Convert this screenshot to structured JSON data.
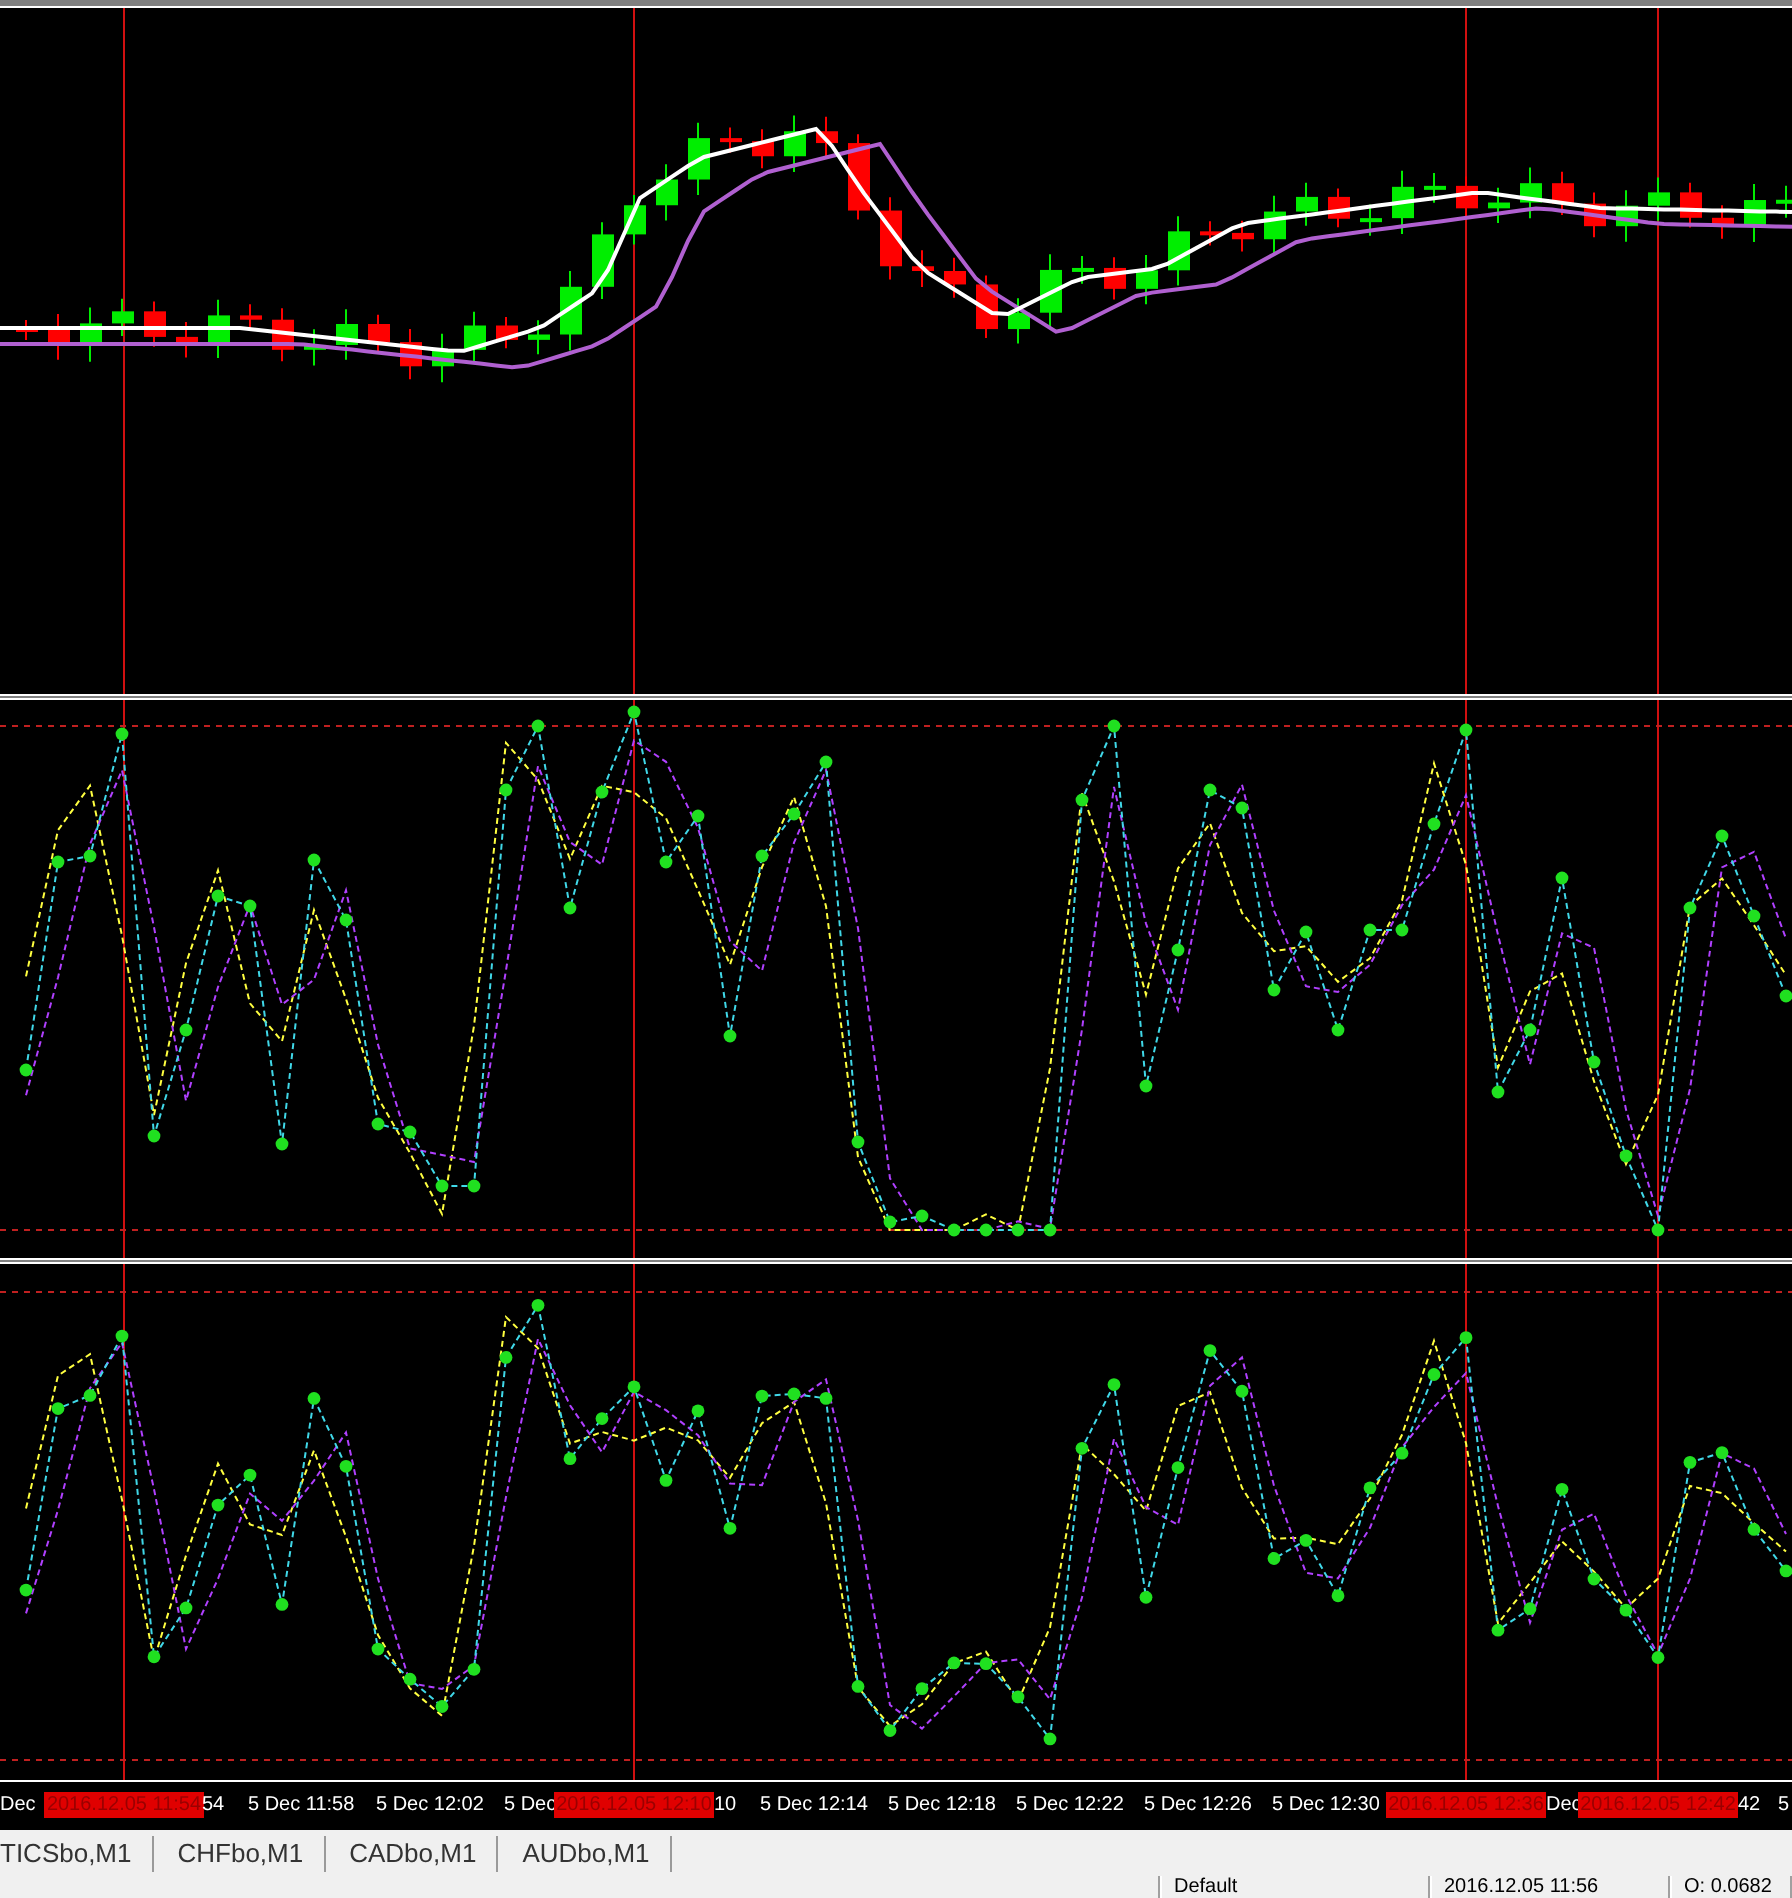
{
  "time_axis": {
    "labels": [
      {
        "text": "Dec",
        "kind": "time"
      },
      {
        "text": "2016.12.05 11:54",
        "kind": "marker"
      },
      {
        "text": "54",
        "kind": "time"
      },
      {
        "text": "5 Dec 11:58",
        "kind": "time"
      },
      {
        "text": "5 Dec 12:02",
        "kind": "time"
      },
      {
        "text": "5 Dec",
        "kind": "time"
      },
      {
        "text": "2016.12.05 12:10",
        "kind": "marker"
      },
      {
        "text": "10",
        "kind": "time"
      },
      {
        "text": "5 Dec 12:14",
        "kind": "time"
      },
      {
        "text": "5 Dec 12:18",
        "kind": "time"
      },
      {
        "text": "5 Dec 12:22",
        "kind": "time"
      },
      {
        "text": "5 Dec 12:26",
        "kind": "time"
      },
      {
        "text": "5 Dec 12:30",
        "kind": "time"
      },
      {
        "text": "2016.12.05 12:36",
        "kind": "marker"
      },
      {
        "text": "Dec",
        "kind": "time"
      },
      {
        "text": "2016.12.05 12:42",
        "kind": "marker"
      },
      {
        "text": "42",
        "kind": "time"
      },
      {
        "text": "5",
        "kind": "time"
      }
    ]
  },
  "tabs": [
    {
      "label": "TICSbo,M1"
    },
    {
      "label": "CHFbo,M1"
    },
    {
      "label": "CADbo,M1"
    },
    {
      "label": "AUDbo,M1"
    }
  ],
  "status_bar": {
    "fields": [
      "Default",
      "2016.12.05 11:56",
      "O: 0.0682"
    ]
  }
}
